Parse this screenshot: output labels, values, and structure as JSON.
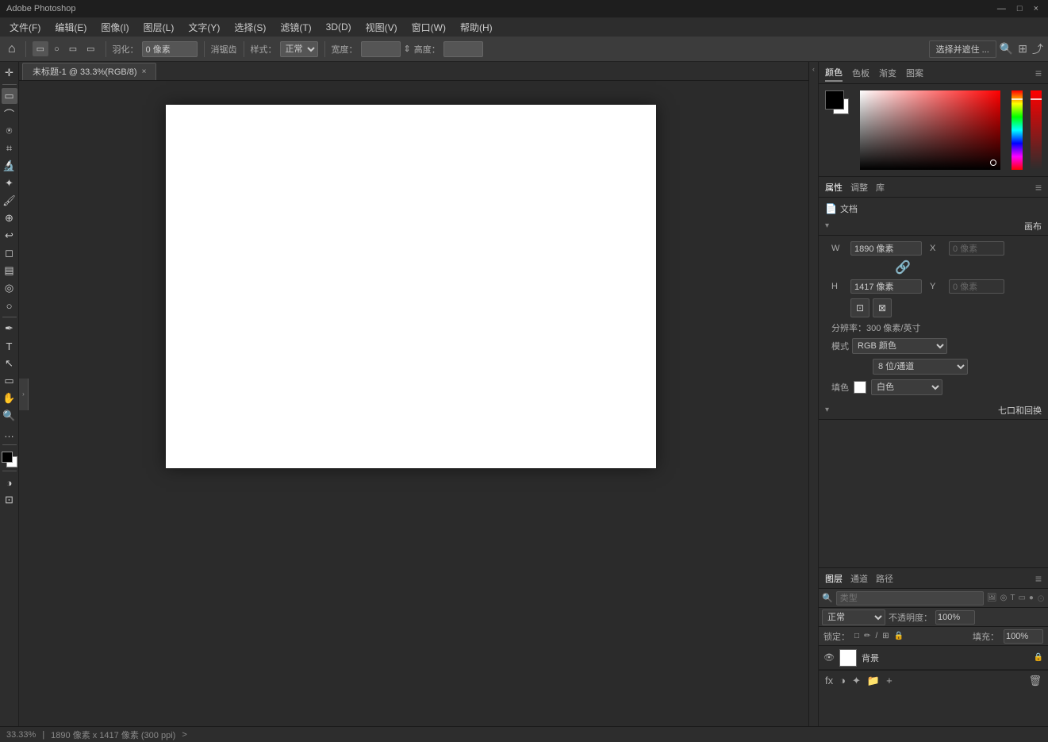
{
  "titlebar": {
    "title": "Adobe Photoshop",
    "controls": [
      "—",
      "□",
      "×"
    ]
  },
  "menubar": {
    "items": [
      "文件(F)",
      "编辑(E)",
      "图像(I)",
      "图层(L)",
      "文字(Y)",
      "选择(S)",
      "滤镜(T)",
      "3D(D)",
      "视图(V)",
      "窗口(W)",
      "帮助(H)"
    ]
  },
  "toolbar": {
    "feather_label": "羽化：",
    "feather_value": "0 像素",
    "antialiasing_label": "消锯齿",
    "style_label": "样式：",
    "style_value": "正常",
    "width_label": "宽度：",
    "width_value": "",
    "height_icon": "⇕",
    "height_label": "高度：",
    "height_value": "",
    "select_subject_btn": "选择并遮住 ...",
    "search_icon": "🔍",
    "layout_icon": "⊞",
    "export_icon": "⬆"
  },
  "tab": {
    "name": "未标题-1 @ 33.3%(RGB/8)",
    "close": "×"
  },
  "color_panel": {
    "tabs": [
      "颜色",
      "色板",
      "渐变",
      "图案"
    ],
    "active_tab": "颜色"
  },
  "properties_panel": {
    "tabs": [
      "属性",
      "调整",
      "库"
    ],
    "active_tab": "属性",
    "document_label": "文档",
    "canvas_section": "画布",
    "w_label": "W",
    "w_value": "1890 像素",
    "x_label": "X",
    "x_value": "0 像素",
    "h_label": "H",
    "h_value": "1417 像素",
    "y_label": "Y",
    "y_value": "0 像素",
    "resolution_label": "分辨率：300 像素/英寸",
    "mode_label": "模式",
    "mode_value": "RGB 颜色",
    "bit_depth_value": "8 位/通道",
    "fill_label": "填色",
    "fill_color": "#ffffff",
    "fill_value": "白色",
    "pixel_aspect_section": "七口和回换"
  },
  "layers_panel": {
    "tabs": [
      "图层",
      "通道",
      "路径"
    ],
    "active_tab": "图层",
    "search_placeholder": "类型",
    "blend_mode": "正常",
    "opacity_label": "不透明度：",
    "opacity_value": "100%",
    "lock_label": "锁定：",
    "lock_icons": [
      "□",
      "✏",
      "/",
      "⊞",
      "🔒"
    ],
    "fill_label": "填充：",
    "fill_value": "100%",
    "layers": [
      {
        "name": "背景",
        "visible": true,
        "locked": true,
        "thumb_color": "#ffffff"
      }
    ],
    "footer_buttons": [
      "fx",
      "◑",
      "✚",
      "📁",
      "🗑"
    ]
  },
  "statusbar": {
    "zoom": "33.33%",
    "size": "1890 像素 x 1417 像素 (300 ppi)",
    "arrow": ">"
  }
}
